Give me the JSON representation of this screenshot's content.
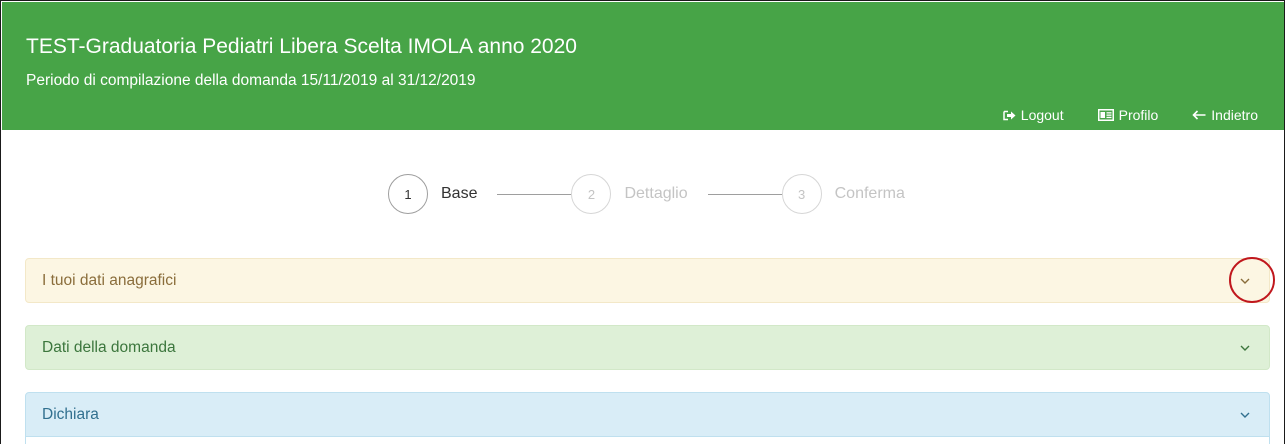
{
  "header": {
    "title": "TEST-Graduatoria Pediatri Libera Scelta IMOLA anno 2020",
    "subtitle": "Periodo di compilazione della domanda 15/11/2019 al 31/12/2019",
    "nav": [
      {
        "label": "Logout",
        "icon": "logout-icon"
      },
      {
        "label": "Profilo",
        "icon": "id-card-icon"
      },
      {
        "label": "Indietro",
        "icon": "arrow-left-icon"
      }
    ],
    "background_color": "#47a447"
  },
  "stepper": {
    "steps": [
      {
        "number": "1",
        "label": "Base",
        "state": "active"
      },
      {
        "number": "2",
        "label": "Dettaglio",
        "state": "inactive"
      },
      {
        "number": "3",
        "label": "Conferma",
        "state": "inactive"
      }
    ]
  },
  "panels": [
    {
      "title": "I tuoi dati anagrafici",
      "style": "warning",
      "color": "#fcf6e3",
      "icon": "chevron-down-icon",
      "highlighted": true
    },
    {
      "title": "Dati della domanda",
      "style": "success",
      "color": "#def0d7",
      "icon": "chevron-down-icon"
    },
    {
      "title": "Dichiara",
      "style": "info",
      "color": "#d9edf7",
      "icon": "chevron-down-icon"
    }
  ]
}
